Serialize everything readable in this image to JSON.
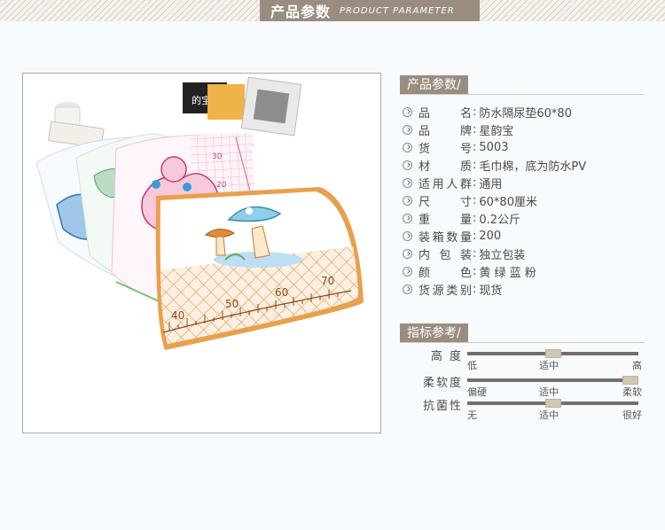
{
  "banner": {
    "title_cn": "产品参数",
    "title_en": "PRODUCT PARAMETER"
  },
  "section_params": "产品参数/",
  "section_indicators": "指标参考/",
  "params": [
    {
      "label": "品名",
      "value": "防水隔尿垫60*80"
    },
    {
      "label": "品牌",
      "value": "星韵宝"
    },
    {
      "label": "货号",
      "value": "5003"
    },
    {
      "label": "材质",
      "value": "毛巾棉，底为防水PV"
    },
    {
      "label": "适用人群",
      "value": "通用"
    },
    {
      "label": "尺寸",
      "value": "60*80厘米"
    },
    {
      "label": "重量",
      "value": "0.2公斤"
    },
    {
      "label": "装箱数量",
      "value": "200"
    },
    {
      "label": "内包装",
      "value": "独立包装"
    },
    {
      "label": "颜色",
      "value": "黄 绿 蓝 粉"
    },
    {
      "label": "货源类别",
      "value": "现货"
    }
  ],
  "indicators": [
    {
      "label": "高 度",
      "low": "低",
      "mid": "适中",
      "high": "高",
      "level": 0.5
    },
    {
      "label": "柔软度",
      "low": "偏硬",
      "mid": "适中",
      "high": "柔软",
      "level": 1.0
    },
    {
      "label": "抗菌性",
      "low": "无",
      "mid": "适中",
      "high": "很好",
      "level": 0.5
    }
  ],
  "photo": {
    "ruler_top": [
      "30",
      "20"
    ],
    "ruler_bottom": [
      "40",
      "50",
      "60",
      "70"
    ],
    "box_text": "的宝"
  }
}
